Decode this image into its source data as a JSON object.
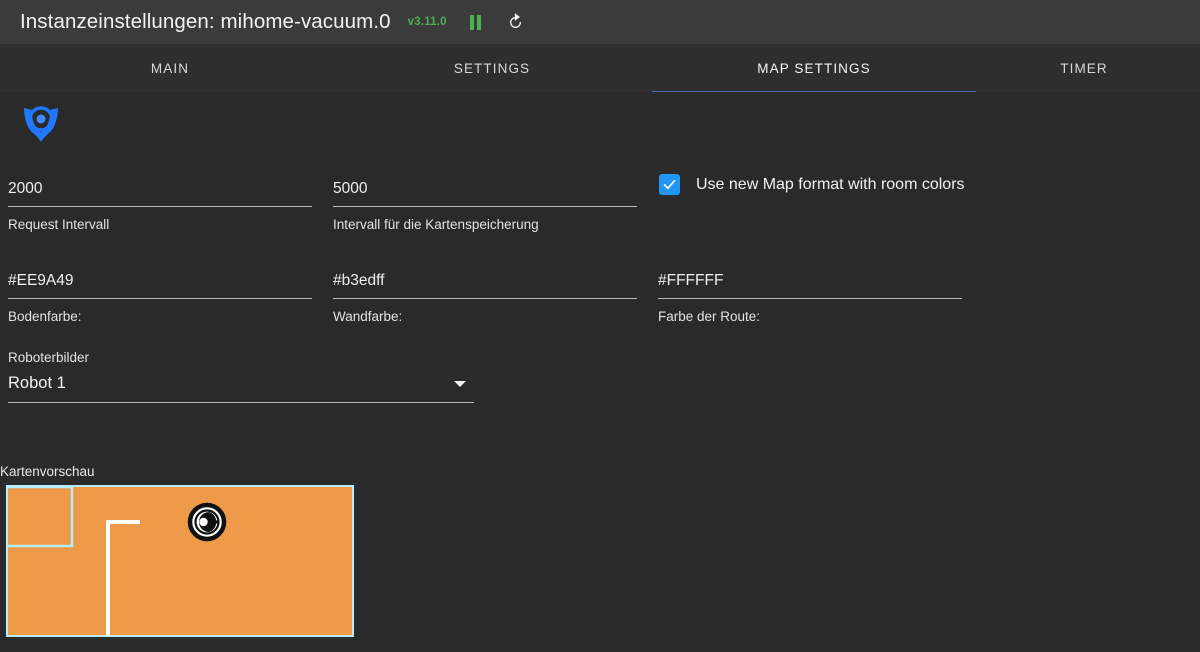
{
  "titlebar": {
    "title": "Instanzeinstellungen: mihome-vacuum.0",
    "version": "v3.11.0",
    "pause_icon": "pause-icon",
    "refresh_icon": "refresh-icon"
  },
  "tabs": [
    {
      "label": "MAIN",
      "active": false
    },
    {
      "label": "SETTINGS",
      "active": false
    },
    {
      "label": "MAP SETTINGS",
      "active": true
    },
    {
      "label": "TIMER",
      "active": false
    }
  ],
  "logo": {
    "icon": "iobroker-logo-icon",
    "color": "#1f78ff"
  },
  "fields": {
    "request_interval": {
      "value": "2000",
      "label": "Request Intervall"
    },
    "map_save_interval": {
      "value": "5000",
      "label": "Intervall für die Kartenspeicherung"
    },
    "floor_color": {
      "value": "#EE9A49",
      "label": "Bodenfarbe:"
    },
    "wall_color": {
      "value": "#b3edff",
      "label": "Wandfarbe:"
    },
    "route_color": {
      "value": "#FFFFFF",
      "label": "Farbe der Route:"
    }
  },
  "checkbox": {
    "label": "Use new Map format with room colors",
    "checked": true,
    "color": "#2196f3",
    "check_icon": "checkmark-icon"
  },
  "select": {
    "caption": "Roboterbilder",
    "value": "Robot 1",
    "caret_icon": "chevron-down-icon"
  },
  "map_preview": {
    "caption": "Kartenvorschau",
    "floor_color": "#EE9A49",
    "wall_color": "#b3edff",
    "route_color": "#FFFFFF",
    "robot_icon": "robot-marker-icon"
  },
  "theme": {
    "titlebar_bg": "#3b3b3b",
    "tabbar_bg": "#2e2e2e",
    "content_bg": "#2a2a2a",
    "accent": "#4a6fa5",
    "version_green": "#4caf50"
  }
}
